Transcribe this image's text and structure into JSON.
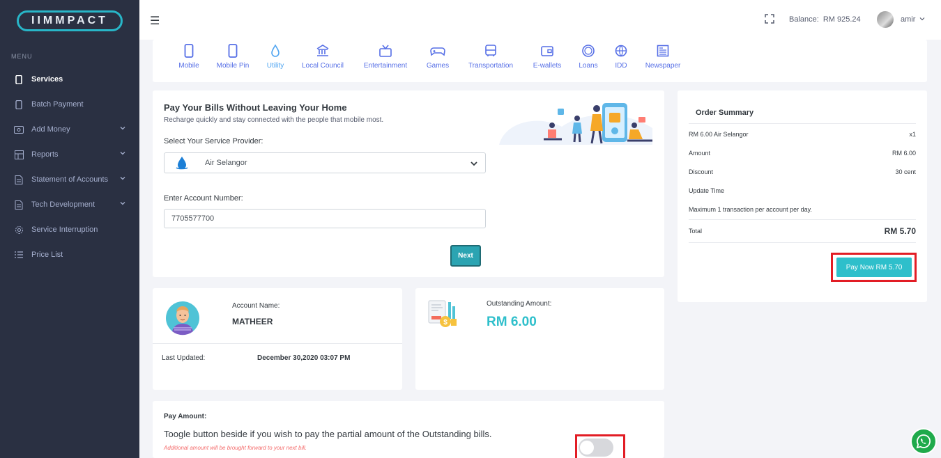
{
  "brand": {
    "logo_text": "IIMMPACT"
  },
  "sidebar": {
    "menu_title": "MENU",
    "items": [
      {
        "label": "Services",
        "icon": "mobile-icon",
        "active": true,
        "chevron": false
      },
      {
        "label": "Batch Payment",
        "icon": "mobile-icon",
        "chevron": false
      },
      {
        "label": "Add Money",
        "icon": "wallet-icon",
        "chevron": true
      },
      {
        "label": "Reports",
        "icon": "grid-icon",
        "chevron": true
      },
      {
        "label": "Statement of Accounts",
        "icon": "document-icon",
        "chevron": true
      },
      {
        "label": "Tech Development",
        "icon": "document-icon",
        "chevron": true
      },
      {
        "label": "Service Interruption",
        "icon": "gear-icon",
        "chevron": false
      },
      {
        "label": "Price List",
        "icon": "list-icon",
        "chevron": false
      }
    ]
  },
  "topbar": {
    "balance_label": "Balance:",
    "balance_value": "RM 925.24",
    "user": "amir"
  },
  "categories": [
    {
      "label": "Mobile",
      "icon": "mobile-icon"
    },
    {
      "label": "Mobile Pin",
      "icon": "mobile-icon"
    },
    {
      "label": "Utility",
      "icon": "water-drop-icon",
      "active": true
    },
    {
      "label": "Local Council",
      "icon": "building-icon"
    },
    {
      "label": "Entertainment",
      "icon": "tv-icon"
    },
    {
      "label": "Games",
      "icon": "gamepad-icon"
    },
    {
      "label": "Transportation",
      "icon": "bus-icon"
    },
    {
      "label": "E-wallets",
      "icon": "wallet-icon"
    },
    {
      "label": "Loans",
      "icon": "coin-icon"
    },
    {
      "label": "IDD",
      "icon": "globe-icon"
    },
    {
      "label": "Newspaper",
      "icon": "newspaper-icon"
    }
  ],
  "pay_form": {
    "title": "Pay Your Bills Without Leaving Your Home",
    "subtitle": "Recharge quickly and stay connected with the people that mobile most.",
    "provider_label": "Select Your Service Provider:",
    "provider_value": "Air Selangor",
    "account_label": "Enter Account Number:",
    "account_value": "7705577700",
    "next_label": "Next"
  },
  "account": {
    "name_label": "Account Name:",
    "name_value": "MATHEER",
    "updated_label": "Last Updated:",
    "updated_value": "December 30,2020 03:07 PM"
  },
  "outstanding": {
    "label": "Outstanding Amount:",
    "value": "RM 6.00"
  },
  "order_summary": {
    "title": "Order Summary",
    "item_label": "RM 6.00 Air Selangor",
    "item_qty": "x1",
    "amount_label": "Amount",
    "amount_value": "RM 6.00",
    "discount_label": "Discount",
    "discount_value": "30 cent",
    "update_label": "Update Time",
    "note": "Maximum 1 transaction per account per day.",
    "total_label": "Total",
    "total_value": "RM 5.70",
    "pay_button": "Pay Now RM 5.70"
  },
  "pay_amount": {
    "title": "Pay Amount:",
    "description": "Toogle button beside if you wish to pay the partial amount of the Outstanding bills.",
    "note": "Additional amount will be brought forward to your next bill."
  },
  "colors": {
    "sidebar_bg": "#2a3042",
    "accent": "#2ebfcb",
    "primary": "#556ee6",
    "highlight_box": "#e21d25",
    "whatsapp": "#1faa4b"
  }
}
